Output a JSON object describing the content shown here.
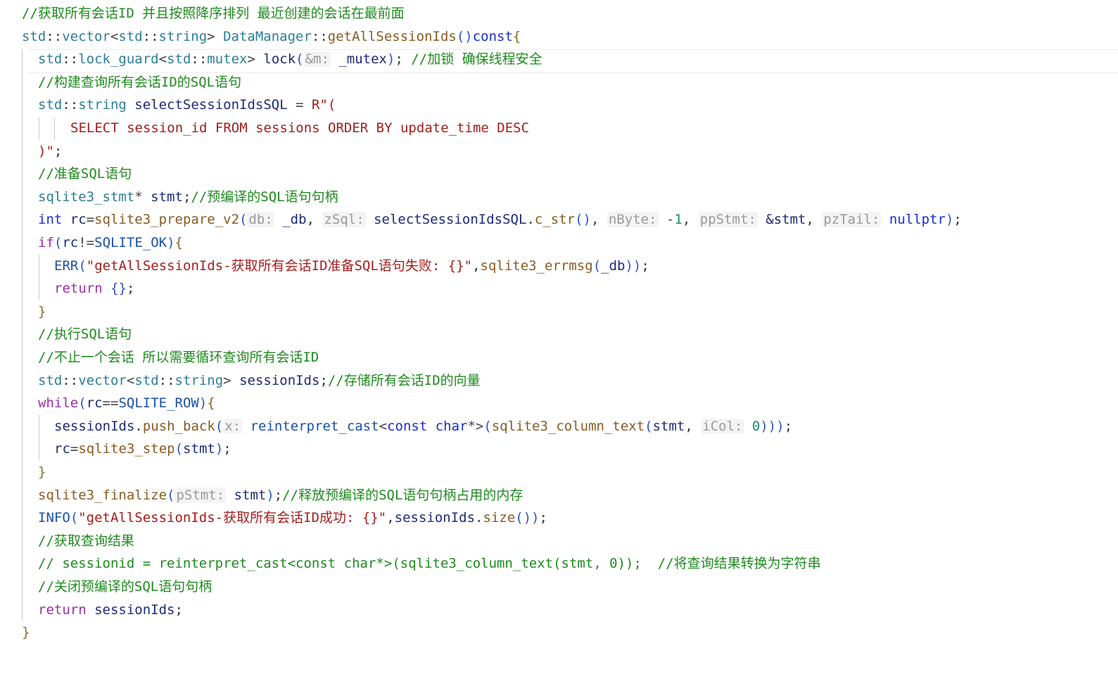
{
  "editor": {
    "colors": {
      "background": "#ffffff",
      "comment": "#1f8a1f",
      "namespace": "#2e7d96",
      "type": "#1a4fa8",
      "keyword": "#1a2ed0",
      "control": "#9b2fa5",
      "string": "#a51d1d",
      "inlay_hint": "#9a9a9a",
      "function": "#8a5a22"
    },
    "lines": [
      [
        [
          "//获取所有会话ID 并且按照降序排列 最近创建的会话在最前面",
          "comment"
        ]
      ],
      [
        [
          "std",
          "ns"
        ],
        [
          "::",
          "punct"
        ],
        [
          "vector",
          "ns"
        ],
        [
          "<",
          "op"
        ],
        [
          "std",
          "ns"
        ],
        [
          "::",
          "punct"
        ],
        [
          "string",
          "ns"
        ],
        [
          "> ",
          "op"
        ],
        [
          "DataManager",
          "ns"
        ],
        [
          "::",
          "punct"
        ],
        [
          "getAllSessionIds",
          "fn"
        ],
        [
          "()",
          "paren"
        ],
        [
          "const",
          "kw"
        ],
        [
          "{",
          "brace"
        ]
      ],
      [
        [
          "std",
          "ns"
        ],
        [
          "::",
          "punct"
        ],
        [
          "lock_guard",
          "ns"
        ],
        [
          "<",
          "op"
        ],
        [
          "std",
          "ns"
        ],
        [
          "::",
          "punct"
        ],
        [
          "mutex",
          "ns"
        ],
        [
          "> ",
          "op"
        ],
        [
          "lock",
          "ident"
        ],
        [
          "(",
          "paren"
        ],
        [
          "&m:",
          "hint"
        ],
        [
          " _mutex",
          "ident"
        ],
        [
          ")",
          "paren"
        ],
        [
          "; ",
          "punct"
        ],
        [
          "//加锁 确保线程安全",
          "comment"
        ]
      ],
      [
        [
          "//构建查询所有会话ID的SQL语句",
          "comment"
        ]
      ],
      [
        [
          "std",
          "ns"
        ],
        [
          "::",
          "punct"
        ],
        [
          "string",
          "ns"
        ],
        [
          " selectSessionIdsSQL ",
          "ident"
        ],
        [
          "= ",
          "op"
        ],
        [
          "R\"(",
          "str"
        ]
      ],
      [
        [
          "SELECT session_id FROM sessions ORDER BY update_time DESC",
          "str"
        ]
      ],
      [
        [
          ")\"",
          "str"
        ],
        [
          ";",
          "punct"
        ]
      ],
      [
        [
          "//准备SQL语句",
          "comment"
        ]
      ],
      [
        [
          "sqlite3_stmt",
          "ns"
        ],
        [
          "* ",
          "op"
        ],
        [
          "stmt",
          "ident"
        ],
        [
          ";",
          "punct"
        ],
        [
          "//预编译的SQL语句句柄",
          "comment"
        ]
      ],
      [
        [
          "int",
          "kw"
        ],
        [
          " rc",
          "ident"
        ],
        [
          "=",
          "op"
        ],
        [
          "sqlite3_prepare_v2",
          "fn"
        ],
        [
          "(",
          "paren"
        ],
        [
          "db:",
          "hint"
        ],
        [
          " _db",
          "ident"
        ],
        [
          ", ",
          "punct"
        ],
        [
          "zSql:",
          "hint"
        ],
        [
          " selectSessionIdsSQL",
          "ident"
        ],
        [
          ".",
          "punct"
        ],
        [
          "c_str",
          "fn"
        ],
        [
          "()",
          "paren"
        ],
        [
          ", ",
          "punct"
        ],
        [
          "nByte:",
          "hint"
        ],
        [
          " -",
          "op"
        ],
        [
          "1",
          "num"
        ],
        [
          ", ",
          "punct"
        ],
        [
          "ppStmt:",
          "hint"
        ],
        [
          " &stmt",
          "ident"
        ],
        [
          ", ",
          "punct"
        ],
        [
          "pzTail:",
          "hint"
        ],
        [
          " nullptr",
          "kw"
        ],
        [
          ")",
          "paren"
        ],
        [
          ";",
          "punct"
        ]
      ],
      [
        [
          "if",
          "ctrl"
        ],
        [
          "(",
          "paren"
        ],
        [
          "rc",
          "ident"
        ],
        [
          "!=",
          "op"
        ],
        [
          "SQLITE_OK",
          "const"
        ],
        [
          ")",
          "paren"
        ],
        [
          "{",
          "brace"
        ]
      ],
      [
        [
          "ERR",
          "macro"
        ],
        [
          "(",
          "paren"
        ],
        [
          "\"getAllSessionIds-获取所有会话ID准备SQL语句失败: {}\"",
          "str"
        ],
        [
          ",",
          "punct"
        ],
        [
          "sqlite3_errmsg",
          "fn"
        ],
        [
          "(",
          "paren"
        ],
        [
          "_db",
          "ident"
        ],
        [
          "))",
          "paren"
        ],
        [
          ";",
          "punct"
        ]
      ],
      [
        [
          "return",
          "ctrl"
        ],
        [
          " ",
          "punct"
        ],
        [
          "{}",
          "paren"
        ],
        [
          ";",
          "punct"
        ]
      ],
      [
        [
          "}",
          "brace"
        ]
      ],
      [
        [
          "//执行SQL语句",
          "comment"
        ]
      ],
      [
        [
          "//不止一个会话 所以需要循环查询所有会话ID",
          "comment"
        ]
      ],
      [
        [
          "std",
          "ns"
        ],
        [
          "::",
          "punct"
        ],
        [
          "vector",
          "ns"
        ],
        [
          "<",
          "op"
        ],
        [
          "std",
          "ns"
        ],
        [
          "::",
          "punct"
        ],
        [
          "string",
          "ns"
        ],
        [
          "> ",
          "op"
        ],
        [
          "sessionIds",
          "ident"
        ],
        [
          ";",
          "punct"
        ],
        [
          "//存储所有会话ID的向量",
          "comment"
        ]
      ],
      [
        [
          "while",
          "ctrl"
        ],
        [
          "(",
          "paren"
        ],
        [
          "rc",
          "ident"
        ],
        [
          "==",
          "op"
        ],
        [
          "SQLITE_ROW",
          "const"
        ],
        [
          ")",
          "paren"
        ],
        [
          "{",
          "brace"
        ]
      ],
      [
        [
          "sessionIds",
          "ident"
        ],
        [
          ".",
          "punct"
        ],
        [
          "push_back",
          "fn"
        ],
        [
          "(",
          "paren"
        ],
        [
          "x:",
          "hint"
        ],
        [
          " reinterpret_cast",
          "type"
        ],
        [
          "<",
          "op"
        ],
        [
          "const",
          "kw"
        ],
        [
          " char",
          "kw"
        ],
        [
          "*>",
          "op"
        ],
        [
          "(",
          "paren"
        ],
        [
          "sqlite3_column_text",
          "fn"
        ],
        [
          "(",
          "paren"
        ],
        [
          "stmt",
          "ident"
        ],
        [
          ", ",
          "punct"
        ],
        [
          "iCol:",
          "hint"
        ],
        [
          " 0",
          "num"
        ],
        [
          ")))",
          "paren"
        ],
        [
          ";",
          "punct"
        ]
      ],
      [
        [
          "rc",
          "ident"
        ],
        [
          "=",
          "op"
        ],
        [
          "sqlite3_step",
          "fn"
        ],
        [
          "(",
          "paren"
        ],
        [
          "stmt",
          "ident"
        ],
        [
          ")",
          "paren"
        ],
        [
          ";",
          "punct"
        ]
      ],
      [
        [
          "}",
          "brace"
        ]
      ],
      [
        [
          "sqlite3_finalize",
          "fn"
        ],
        [
          "(",
          "paren"
        ],
        [
          "pStmt:",
          "hint"
        ],
        [
          " stmt",
          "ident"
        ],
        [
          ")",
          "paren"
        ],
        [
          ";",
          "punct"
        ],
        [
          "//释放预编译的SQL语句句柄占用的内存",
          "comment"
        ]
      ],
      [
        [
          "INFO",
          "macro"
        ],
        [
          "(",
          "paren"
        ],
        [
          "\"getAllSessionIds-获取所有会话ID成功: {}\"",
          "str"
        ],
        [
          ",",
          "punct"
        ],
        [
          "sessionIds",
          "ident"
        ],
        [
          ".",
          "punct"
        ],
        [
          "size",
          "fn"
        ],
        [
          "())",
          "paren"
        ],
        [
          ";",
          "punct"
        ]
      ],
      [
        [
          "//获取查询结果",
          "comment"
        ]
      ],
      [
        [
          "// sessionid = reinterpret_cast<const char*>(sqlite3_column_text(stmt, 0));  //将查询结果转换为字符串",
          "comment"
        ]
      ],
      [
        [
          "//关闭预编译的SQL语句句柄",
          "comment"
        ]
      ],
      [
        [
          "return",
          "ctrl"
        ],
        [
          " sessionIds",
          "ident"
        ],
        [
          ";",
          "punct"
        ]
      ],
      [
        [
          "}",
          "brace"
        ]
      ]
    ]
  }
}
